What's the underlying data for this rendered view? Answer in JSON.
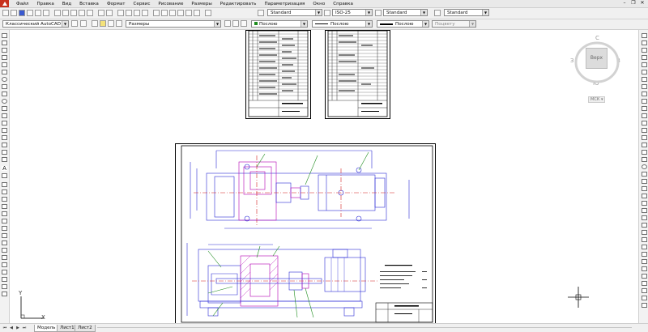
{
  "menu": {
    "items": [
      "Файл",
      "Правка",
      "Вид",
      "Вставка",
      "Формат",
      "Сервис",
      "Рисование",
      "Размеры",
      "Редактировать",
      "Параметризация",
      "Окно",
      "Справка"
    ]
  },
  "toolbar1": {
    "text_style": "Standard",
    "dim_style": "ISO-25",
    "table_style": "Standard",
    "multileader_style": "Standard"
  },
  "toolbar2": {
    "workspace": "Классический AutoCAD",
    "toolbar_label": "Размеры",
    "color": "Послою",
    "linetype": "Послою",
    "lineweight": "Послою",
    "plotstyle": "Поцвету"
  },
  "viewcube": {
    "north": "С",
    "south": "Ю",
    "west": "З",
    "east": "В",
    "top_face": "Верх",
    "ucs_menu": "МСК"
  },
  "ucs_icon": {
    "x": "X",
    "y": "Y"
  },
  "tabs": {
    "model": "Модель",
    "layout1": "Лист1",
    "layout2": "Лист2"
  },
  "colors": {
    "drawing_blue": "#2b2bd6",
    "drawing_red": "#d21e1e",
    "drawing_magenta": "#b400b4",
    "drawing_green": "#1e8c1e"
  }
}
